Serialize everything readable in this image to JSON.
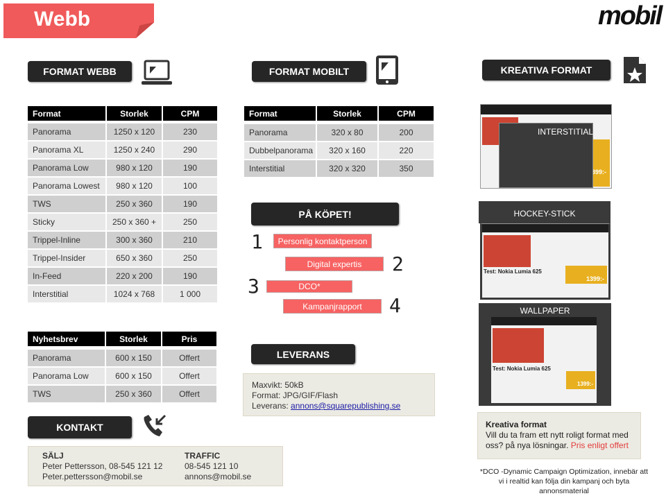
{
  "header": {
    "title": "Webb",
    "logo": "mobil"
  },
  "sections": {
    "web": "FORMAT WEBB",
    "mobile": "FORMAT MOBILT",
    "creative": "KREATIVA FORMAT",
    "extras": "PÅ KÖPET!",
    "delivery": "LEVERANS",
    "contact": "KONTAKT"
  },
  "web_table": {
    "headers": [
      "Format",
      "Storlek",
      "CPM"
    ],
    "rows": [
      [
        "Panorama",
        "1250 x 120",
        "230"
      ],
      [
        "Panorama XL",
        "1250 x 240",
        "290"
      ],
      [
        "Panorama Low",
        "980 x 120",
        "190"
      ],
      [
        "Panorama Lowest",
        "980 x 120",
        "100"
      ],
      [
        "TWS",
        "250 x 360",
        "190"
      ],
      [
        "Sticky",
        "250 x 360 +",
        "250"
      ],
      [
        "Trippel-Inline",
        "300 x 360",
        "210"
      ],
      [
        "Trippel-Insider",
        "650 x 360",
        "250"
      ],
      [
        "In-Feed",
        "220 x 200",
        "190"
      ],
      [
        "Interstitial",
        "1024 x 768",
        "1 000"
      ]
    ]
  },
  "mobile_table": {
    "headers": [
      "Format",
      "Storlek",
      "CPM"
    ],
    "rows": [
      [
        "Panorama",
        "320 x 80",
        "200"
      ],
      [
        "Dubbelpanorama",
        "320 x 160",
        "220"
      ],
      [
        "Interstitial",
        "320 x 320",
        "350"
      ]
    ]
  },
  "newsletter_table": {
    "headers": [
      "Nyhetsbrev",
      "Storlek",
      "Pris"
    ],
    "rows": [
      [
        "Panorama",
        "600 x 150",
        "Offert"
      ],
      [
        "Panorama Low",
        "600 x 150",
        "Offert"
      ],
      [
        "TWS",
        "250 x 360",
        "Offert"
      ]
    ]
  },
  "extras": [
    {
      "n": "1",
      "label": "Personlig kontaktperson"
    },
    {
      "n": "2",
      "label": "Digital expertis"
    },
    {
      "n": "3",
      "label": "DCO*"
    },
    {
      "n": "4",
      "label": "Kampanjrapport"
    }
  ],
  "delivery": {
    "maxweight": "Maxvikt: 50kB",
    "format": "Format: JPG/GIF/Flash",
    "label": "Leverans: ",
    "email": "annons@squarepublishing.se"
  },
  "creative": {
    "interstitial": "INTERSTITIAL",
    "hockey": "HOCKEY-STICK",
    "wallpaper": "WALLPAPER",
    "shot_headline": "Test: Nokia Lumia 625",
    "price": "1399:-",
    "price_small": "399:-"
  },
  "creative_info": {
    "title": "Kreativa format",
    "text": "Vill du ta fram ett nytt roligt format med oss? på nya lösningar. ",
    "offer": "Pris enligt offert"
  },
  "footnote": "*DCO -Dynamic Campaign Optimization, innebär att vi i realtid kan följa din kampanj och byta annonsmaterial",
  "contact": {
    "sales_title": "SÄLJ",
    "sales_line1": "Peter Pettersson, 08-545 121 12",
    "sales_line2": "Peter.pettersson@mobil.se",
    "traffic_title": "TRAFFIC",
    "traffic_line1": "08-545 121 10",
    "traffic_line2": "annons@mobil.se"
  },
  "colors": {
    "accent": "#f05a5a",
    "dark": "#262626",
    "offer": "#e23b3b"
  }
}
